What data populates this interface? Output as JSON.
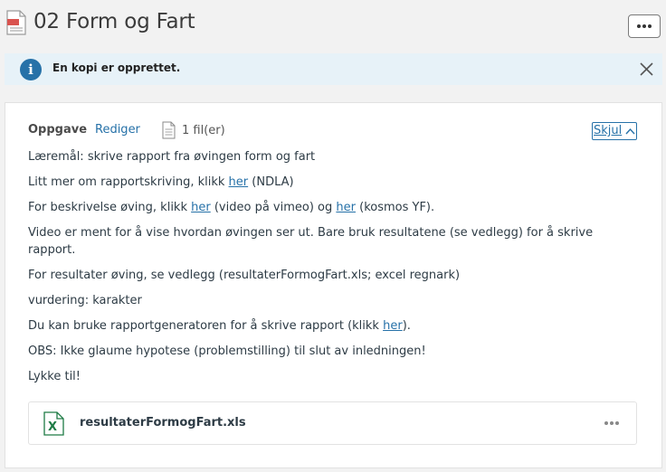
{
  "header": {
    "title": "02 Form og Fart",
    "doc_icon": "document-icon",
    "more_icon": "more-dots-icon"
  },
  "alert": {
    "message": "En kopi er opprettet.",
    "icon": "info-icon",
    "close_icon": "close-icon",
    "accent_color": "#2671a8",
    "background_color": "#e7f2f8"
  },
  "card": {
    "label": "Oppgave",
    "edit_label": "Rediger",
    "files_count": "1 fil(er)",
    "hide_label": "Skjul",
    "paragraphs": {
      "p1": "Læremål: skrive rapport fra øvingen form og fart",
      "p2_a": "Litt mer om rapportskriving, klikk ",
      "p2_link": "her",
      "p2_b": " (NDLA)",
      "p3_a": "For beskrivelse øving, klikk ",
      "p3_link1": "her",
      "p3_b": " (video på vimeo) og ",
      "p3_link2": "her",
      "p3_c": " (kosmos YF).",
      "p4": "Video er ment for å vise hvordan øvingen ser ut. Bare bruk resultatene (se vedlegg) for å skrive rapport.",
      "p5": "For resultater øving, se vedlegg (resultaterFormogFart.xls; excel regnark)",
      "p6": "vurdering: karakter",
      "p7_a": "Du kan bruke rapportgeneratoren for å skrive rapport (klikk ",
      "p7_link": "her",
      "p7_b": ").",
      "p8": "OBS: Ikke glaume hypotese (problemstilling) til slut av inledningen!",
      "p9": "Lykke til!"
    },
    "attachment": {
      "name": "resultaterFormogFart.xls",
      "icon": "excel-file-icon",
      "more_icon": "more-dots-icon"
    },
    "link_color": "#2671a8"
  }
}
